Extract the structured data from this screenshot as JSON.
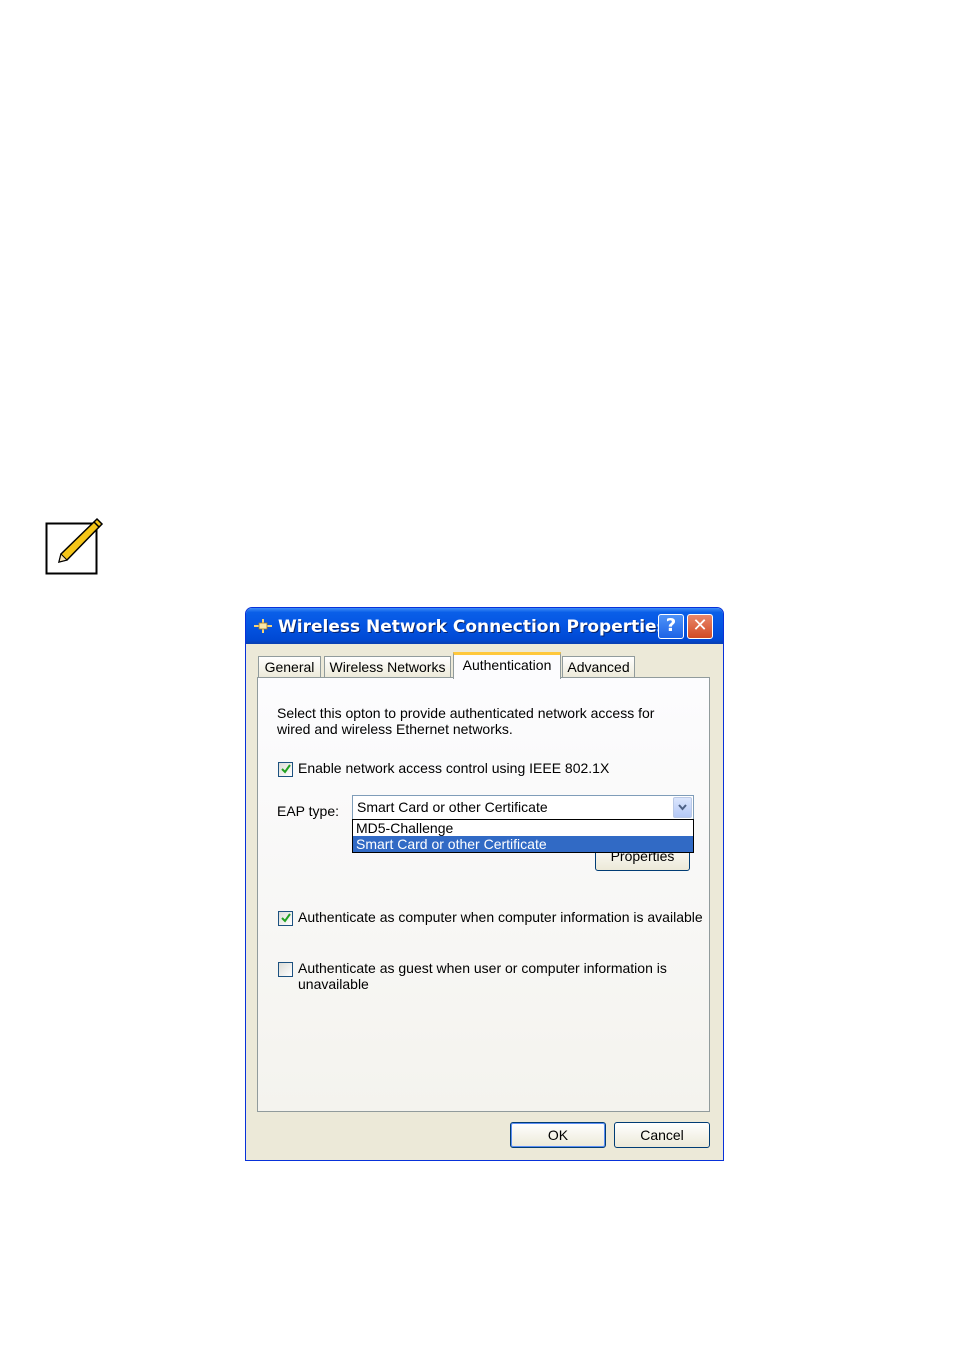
{
  "icons": {
    "note": "note-pencil-icon",
    "title": "network-plug-icon"
  },
  "dialog": {
    "title": "Wireless Network Connection Properties",
    "help_button": "?",
    "close_button": "✕",
    "tabs": [
      {
        "label": "General",
        "active": false
      },
      {
        "label": "Wireless Networks",
        "active": false
      },
      {
        "label": "Authentication",
        "active": true
      },
      {
        "label": "Advanced",
        "active": false
      }
    ],
    "description_line1": "Select this opton to provide authenticated network access for",
    "description_line2": "wired and wireless Ethernet networks.",
    "enable_8021x": {
      "label": "Enable network access control using IEEE 802.1X",
      "checked": true
    },
    "eap_type": {
      "label": "EAP type:",
      "selected": "Smart Card or other Certificate",
      "options": [
        {
          "label": "MD5-Challenge",
          "highlighted": false
        },
        {
          "label": "Smart Card or other Certificate",
          "highlighted": true
        }
      ]
    },
    "properties_button": "Properties",
    "auth_as_computer": {
      "label": "Authenticate as computer when computer information is available",
      "checked": true
    },
    "auth_as_guest": {
      "label_line1": "Authenticate as guest when user or computer information is",
      "label_line2": "unavailable",
      "checked": false
    },
    "ok_button": "OK",
    "cancel_button": "Cancel"
  },
  "colors": {
    "titlebar": "#0454e2",
    "selection": "#316ac5",
    "tab_accent": "#ffc83c",
    "dialog_face": "#ece9d8",
    "close_button": "#d14b25"
  }
}
